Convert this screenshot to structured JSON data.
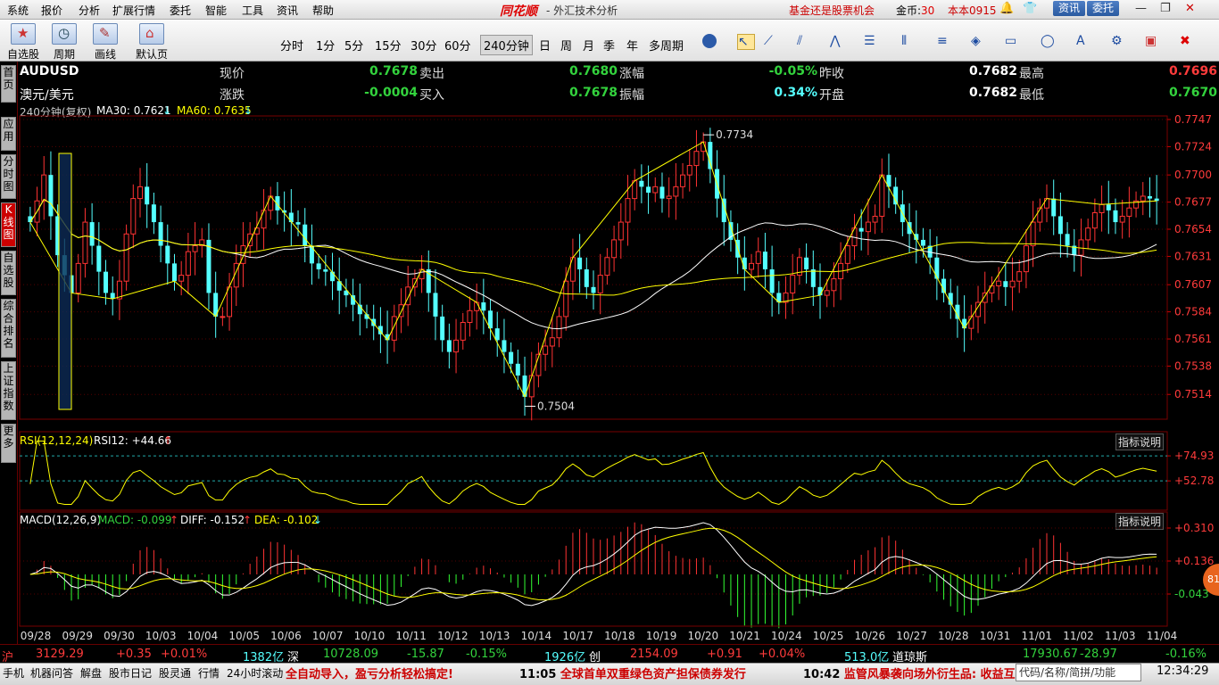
{
  "menu": [
    "系统",
    "报价",
    "分析",
    "扩展行情",
    "委托",
    "智能",
    "工具",
    "资讯",
    "帮助"
  ],
  "app": {
    "brand": "同花顺",
    "title": "- 外汇技术分析",
    "promo": "基金还是股票机会",
    "coins_label": "金币:",
    "coins_value": "30",
    "version": "本本0915",
    "btn_news": "资讯",
    "btn_trade": "委托"
  },
  "toolbar": {
    "groups": [
      {
        "label": "自选股"
      },
      {
        "label": "周期"
      },
      {
        "label": "画线"
      },
      {
        "label": "默认页"
      }
    ],
    "periods": [
      "分时",
      "1分",
      "5分",
      "15分",
      "30分",
      "60分",
      "240分钟",
      "日",
      "周",
      "月",
      "季",
      "年",
      "多周期"
    ],
    "active_period": "240分钟"
  },
  "left_tabs": [
    "首页",
    "应用",
    "分时图",
    "K线图",
    "自选股",
    "综合排名",
    "上证指数",
    "更多"
  ],
  "quote": {
    "symbol": "AUDUSD",
    "name": "澳元/美元",
    "current_label": "现价",
    "current": "0.7678",
    "change_label": "涨跌",
    "change": "-0.0004",
    "ask_label": "卖出",
    "ask": "0.7680",
    "bid_label": "买入",
    "bid": "0.7678",
    "pct_label": "涨幅",
    "pct": "-0.05%",
    "amp_label": "振幅",
    "amp": "0.34%",
    "prev_label": "昨收",
    "prev": "0.7682",
    "open_label": "开盘",
    "open": "0.7682",
    "high_label": "最高",
    "high": "0.7696",
    "low_label": "最低",
    "low": "0.7670"
  },
  "indicators": {
    "main": {
      "period": "240分钟(复权)",
      "ma30": "MA30: 0.7621",
      "ma60": "MA60: 0.7635",
      "arrow": "↓"
    },
    "rsi": {
      "label": "RSI(12,12,24)",
      "value": "RSI12: +44.66",
      "arrow": "↑",
      "hint": "指标说明"
    },
    "macd": {
      "label": "MACD(12,26,9)",
      "macd": "MACD: -0.099",
      "diff": "DIFF: -0.152",
      "dea": "DEA: -0.102",
      "arrow_up": "↑",
      "arrow_down": "↓",
      "hint": "指标说明"
    }
  },
  "chart_data": {
    "type": "candlestick",
    "price_ticks": [
      "0.7747",
      "0.7724",
      "0.7700",
      "0.7677",
      "0.7654",
      "0.7631",
      "0.7607",
      "0.7584",
      "0.7561",
      "0.7538",
      "0.7514"
    ],
    "price_range": [
      0.7493,
      0.775
    ],
    "annotations": [
      {
        "label": "0.7734",
        "value": 0.7734,
        "type": "high"
      },
      {
        "label": "0.7504",
        "value": 0.7504,
        "type": "low"
      }
    ],
    "rsi_ticks": [
      "+74.93",
      "+52.78"
    ],
    "macd_ticks": [
      "+0.310",
      "+0.136",
      "-0.043"
    ],
    "dates": [
      "09/28",
      "09/29",
      "09/30",
      "10/03",
      "10/04",
      "10/05",
      "10/06",
      "10/07",
      "10/10",
      "10/11",
      "10/12",
      "10/13",
      "10/14",
      "10/17",
      "10/18",
      "10/19",
      "10/20",
      "10/21",
      "10/24",
      "10/25",
      "10/26",
      "10/27",
      "10/28",
      "10/31",
      "11/01",
      "11/02",
      "11/03",
      "11/04"
    ],
    "closes": [
      0.766,
      0.7678,
      0.77,
      0.7665,
      0.7632,
      0.7615,
      0.76,
      0.7625,
      0.766,
      0.764,
      0.7618,
      0.76,
      0.7595,
      0.761,
      0.765,
      0.768,
      0.769,
      0.7675,
      0.766,
      0.764,
      0.7625,
      0.761,
      0.7615,
      0.7635,
      0.764,
      0.7645,
      0.76,
      0.758,
      0.758,
      0.7605,
      0.7625,
      0.764,
      0.765,
      0.7655,
      0.767,
      0.7682,
      0.767,
      0.7668,
      0.766,
      0.7658,
      0.764,
      0.7625,
      0.762,
      0.7618,
      0.761,
      0.7602,
      0.7598,
      0.759,
      0.7582,
      0.7578,
      0.7572,
      0.7565,
      0.756,
      0.758,
      0.759,
      0.7605,
      0.7612,
      0.762,
      0.76,
      0.758,
      0.756,
      0.755,
      0.756,
      0.7575,
      0.7585,
      0.7592,
      0.7585,
      0.757,
      0.756,
      0.755,
      0.754,
      0.753,
      0.7512,
      0.753,
      0.7548,
      0.7555,
      0.7562,
      0.758,
      0.761,
      0.763,
      0.762,
      0.7605,
      0.76,
      0.7615,
      0.763,
      0.7645,
      0.766,
      0.768,
      0.7695,
      0.769,
      0.7685,
      0.769,
      0.768,
      0.7682,
      0.769,
      0.77,
      0.7708,
      0.772,
      0.7728,
      0.7705,
      0.768,
      0.766,
      0.7645,
      0.763,
      0.762,
      0.7625,
      0.7635,
      0.762,
      0.76,
      0.7592,
      0.76,
      0.7615,
      0.763,
      0.762,
      0.7605,
      0.7598,
      0.7602,
      0.7612,
      0.7625,
      0.764,
      0.7655,
      0.7652,
      0.766,
      0.7665,
      0.77,
      0.769,
      0.7675,
      0.766,
      0.765,
      0.7645,
      0.764,
      0.763,
      0.7612,
      0.76,
      0.759,
      0.7578,
      0.757,
      0.758,
      0.7592,
      0.76,
      0.7606,
      0.761,
      0.7605,
      0.761,
      0.7618,
      0.764,
      0.766,
      0.7672,
      0.768,
      0.7665,
      0.765,
      0.764,
      0.7632,
      0.7645,
      0.7655,
      0.7668,
      0.7675,
      0.767,
      0.766,
      0.7665,
      0.7672,
      0.7678,
      0.7682,
      0.768,
      0.7678
    ]
  },
  "statusbar": {
    "sh": {
      "name": "沪",
      "value": "3129.29",
      "chg": "+0.35",
      "pct": "+0.01%",
      "amt": "1382亿"
    },
    "sz": {
      "name": "深",
      "value": "10728.09",
      "chg": "-15.87",
      "pct": "-0.15%",
      "amt": "1926亿"
    },
    "cy": {
      "name": "创",
      "value": "2154.09",
      "chg": "+0.91",
      "pct": "+0.04%",
      "amt": "513.0亿"
    },
    "dj": {
      "name": "道琼斯",
      "value": "17930.67",
      "chg": "-28.97",
      "pct": "-0.16%"
    }
  },
  "bottombar": {
    "items": [
      "手机",
      "机器问答",
      "解盘",
      "股市日记",
      "股灵通",
      "行情",
      "24小时滚动"
    ],
    "news1": "全自动导入，盈亏分析轻松搞定!",
    "news2_time": "11:05",
    "news2": "全球首单双重绿色资产担保债券发行",
    "news3_time": "10:42",
    "news3": "监管风暴袭向场外衍生品: 收益互",
    "code_placeholder": "代码/名称/简拼/功能",
    "clock": "12:34:29",
    "badge": "81"
  }
}
